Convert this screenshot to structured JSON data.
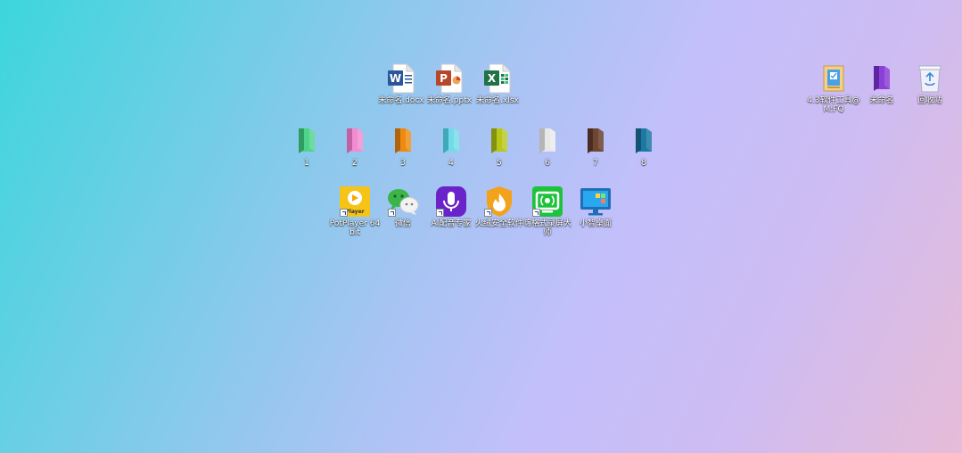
{
  "top_files": [
    {
      "name": "word-docx-icon",
      "label": "未命名.docx",
      "letter": "W",
      "accent": "#2b579a"
    },
    {
      "name": "powerpoint-pptx-icon",
      "label": "未命名.pptx",
      "letter": "P",
      "accent": "#b7472a"
    },
    {
      "name": "excel-xlsx-icon",
      "label": "未命名.xlsx",
      "letter": "X",
      "accent": "#217346"
    }
  ],
  "folders": [
    {
      "label": "1",
      "color": "#4fd38a"
    },
    {
      "label": "2",
      "color": "#f08ccf"
    },
    {
      "label": "3",
      "color": "#ee8a10"
    },
    {
      "label": "4",
      "color": "#72dbe8"
    },
    {
      "label": "5",
      "color": "#b8c71a"
    },
    {
      "label": "6",
      "color": "#e8e8e8"
    },
    {
      "label": "7",
      "color": "#6e4634"
    },
    {
      "label": "8",
      "color": "#1e78a4"
    }
  ],
  "apps": [
    {
      "name": "potplayer-icon",
      "label": "PotPlayer 64 bit",
      "sub": "Player",
      "bg": "#f6c417"
    },
    {
      "name": "wechat-icon",
      "label": "微信",
      "bg": "#3bb54a"
    },
    {
      "name": "ai-speech-icon",
      "label": "AI配音专家",
      "bg": "#6a22c9"
    },
    {
      "name": "huorong-icon",
      "label": "火绒安全软件",
      "bg": "#f2a21b"
    },
    {
      "name": "screen-record-icon",
      "label": "嗨格式录屏大师",
      "bg": "#1ec23c"
    },
    {
      "name": "mini-desktop-icon",
      "label": "小智桌面",
      "bg": "#1e6fb8"
    }
  ],
  "right_icons": [
    {
      "name": "software-store-icon",
      "label": "4.3软件工具@M:FQ"
    },
    {
      "name": "purple-folder-icon",
      "label": "未命名",
      "color": "#8a3fd6"
    },
    {
      "name": "recycle-bin-icon",
      "label": "回收站"
    }
  ]
}
